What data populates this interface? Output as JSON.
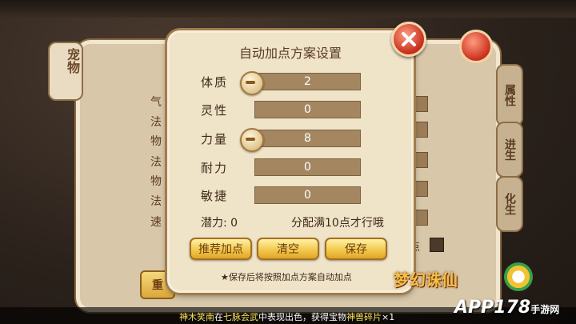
{
  "dialog": {
    "title": "自动加点方案设置",
    "attributes": [
      {
        "label": "体质",
        "value": "2",
        "has_minus": true
      },
      {
        "label": "灵性",
        "value": "0",
        "has_minus": false
      },
      {
        "label": "力量",
        "value": "8",
        "has_minus": true
      },
      {
        "label": "耐力",
        "value": "0",
        "has_minus": false
      },
      {
        "label": "敏捷",
        "value": "0",
        "has_minus": false
      }
    ],
    "potential": "潜力: 0",
    "hint": "分配满10点才行哦",
    "buttons": {
      "recommend": "推荐加点",
      "clear": "清空",
      "save": "保存"
    },
    "note": "★保存后将按照加点方案自动加点"
  },
  "background": {
    "left_tab": "宠物",
    "row_labels": [
      "气",
      "法",
      "物",
      "法",
      "物",
      "法",
      "速"
    ],
    "right_tabs": [
      "属性",
      "进生",
      "化生"
    ],
    "bottom_button": "重",
    "check_label": "点"
  },
  "chat": {
    "segments": [
      {
        "text": "神木笑南",
        "color": "yellow"
      },
      {
        "text": "在",
        "color": "white"
      },
      {
        "text": "七脉会武",
        "color": "yellow"
      },
      {
        "text": "中表现出色，获得宝物",
        "color": "white"
      },
      {
        "text": "神兽碎片",
        "color": "yellow"
      },
      {
        "text": "×1",
        "color": "white"
      }
    ]
  },
  "branding": {
    "game_logo": "梦幻诛仙",
    "watermark": "APP178",
    "watermark_sub": "手游网"
  },
  "colors": {
    "panel": "#efe3c8",
    "bar": "#a48761",
    "button_gold": "#f3c94e",
    "text_brown": "#3e2a19"
  }
}
